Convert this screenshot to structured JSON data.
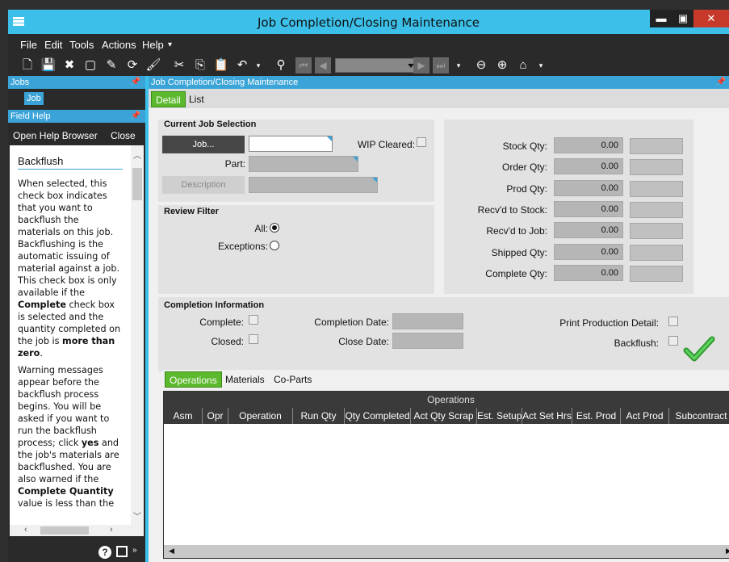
{
  "window": {
    "title": "Job Completion/Closing Maintenance",
    "minimize": "▬",
    "maximize": "▣",
    "close": "✕"
  },
  "menu": {
    "file": "File",
    "edit": "Edit",
    "tools": "Tools",
    "actions": "Actions",
    "help": "Help",
    "more": "▾"
  },
  "left": {
    "jobs_header": "Jobs",
    "tree_item": "Job",
    "field_help_header": "Field Help",
    "open_help_browser": "Open Help Browser",
    "close": "Close",
    "help_title": "Backflush",
    "help_p1_a": "When selected, this check box indicates that you want to backflush the materials on this job. Backflushing is the automatic issuing of material against a job. This check box is only available if the ",
    "help_p1_b": "Complete",
    "help_p1_c": " check box is selected and the quantity completed on the job is ",
    "help_p1_d": "more than zero",
    "help_p1_e": ".",
    "help_p2_a": "Warning messages appear before the backflush process begins. You will be asked if you want to run the backflush process; click ",
    "help_p2_b": "yes",
    "help_p2_c": " and the job's materials are backflushed. You are also warned if the ",
    "help_p2_d": "Complete Quantity",
    "help_p2_e": " value is less than the"
  },
  "main": {
    "header": "Job Completion/Closing Maintenance",
    "tab_detail": "Detail",
    "tab_list": "List",
    "current_job_title": "Current Job Selection",
    "job_button": "Job...",
    "job_value": "",
    "wip_cleared": "WIP Cleared:",
    "part_label": "Part:",
    "description_button": "Description",
    "review_filter_title": "Review Filter",
    "all_label": "All:",
    "exceptions_label": "Exceptions:",
    "qty": [
      {
        "label": "Stock Qty:",
        "value": "0.00"
      },
      {
        "label": "Order Qty:",
        "value": "0.00"
      },
      {
        "label": "Prod Qty:",
        "value": "0.00"
      },
      {
        "label": "Recv'd to Stock:",
        "value": "0.00"
      },
      {
        "label": "Recv'd to Job:",
        "value": "0.00"
      },
      {
        "label": "Shipped Qty:",
        "value": "0.00"
      },
      {
        "label": "Complete Qty:",
        "value": "0.00"
      }
    ],
    "completion_title": "Completion Information",
    "complete_label": "Complete:",
    "closed_label": "Closed:",
    "completion_date_label": "Completion Date:",
    "close_date_label": "Close Date:",
    "print_detail_label": "Print Production Detail:",
    "backflush_label": "Backflush:",
    "subtab_operations": "Operations",
    "subtab_materials": "Materials",
    "subtab_coparts": "Co-Parts",
    "grid_title": "Operations",
    "columns": [
      "Asm",
      "Opr",
      "Operation",
      "Run Qty",
      "Qty Completed",
      "Act Qty Scrap",
      "Est. Setup",
      "Act Set Hrs",
      "Est. Prod",
      "Act Prod",
      "Subcontract"
    ]
  }
}
